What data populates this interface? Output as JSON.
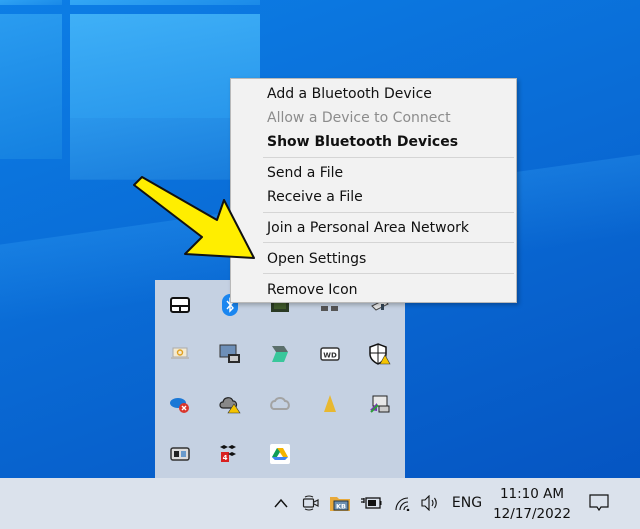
{
  "context_menu": {
    "items": [
      {
        "label": "Add a Bluetooth Device",
        "state": "enabled"
      },
      {
        "label": "Allow a Device to Connect",
        "state": "disabled"
      },
      {
        "label": "Show Bluetooth Devices",
        "state": "default"
      },
      {
        "label": "Send a File",
        "state": "enabled"
      },
      {
        "label": "Receive a File",
        "state": "enabled"
      },
      {
        "label": "Join a Personal Area Network",
        "state": "enabled"
      },
      {
        "label": "Open Settings",
        "state": "enabled",
        "highlighted_by_annotation": true
      },
      {
        "label": "Remove Icon",
        "state": "enabled"
      }
    ]
  },
  "annotation": {
    "type": "arrow",
    "color": "#ffee00",
    "points_to": "Open Settings"
  },
  "tray_overflow": {
    "icons": [
      "touchpad-icon",
      "bluetooth-icon",
      "nvidia-icon",
      "network-drive-icon",
      "usb-device-icon",
      "laptop-sync-icon",
      "display-monitor-icon",
      "app-s-icon",
      "wd-drive-icon",
      "windows-security-warning-icon",
      "onedrive-error-icon",
      "cloud-warning-icon",
      "creative-cloud-icon",
      "vlc-cone-icon",
      "printer-icon",
      "media-player-icon",
      "dropbox-update-icon",
      "google-drive-icon"
    ]
  },
  "taskbar": {
    "tray_icons": [
      "show-hidden-icons-chevron",
      "meet-now-icon",
      "kb-folder-icon",
      "battery-charging-icon",
      "wifi-icon",
      "volume-icon"
    ],
    "language": "ENG",
    "time": "11:10 AM",
    "date": "12/17/2022",
    "notifications_label": "Action Center"
  }
}
